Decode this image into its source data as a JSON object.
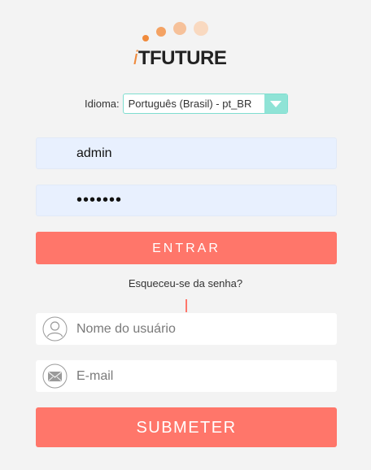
{
  "brand": {
    "logo_prefix": "i",
    "logo_name": "TFUTURE",
    "colors": {
      "dot_dark": "#f08a3c",
      "dot_mid": "#f6b583",
      "dot_light": "#f9d7bc"
    }
  },
  "language": {
    "label": "Idioma:",
    "selected": "Português (Brasil) - pt_BR",
    "icon": "chevron-down-icon"
  },
  "login": {
    "username_value": "admin",
    "password_value": "•••••••",
    "submit_label": "ENTRAR"
  },
  "forgot_link": "Esqueceu-se da senha?",
  "recovery": {
    "username_placeholder": "Nome do usuário",
    "username_icon": "user-icon",
    "email_placeholder": "E-mail",
    "email_icon": "envelope-icon",
    "submit_label": "SUBMETER"
  },
  "theme": {
    "accent": "#ff766a",
    "select_accent": "#8fe3d6",
    "autofill_bg": "#e8f0fe",
    "background": "#f3f3f3"
  }
}
